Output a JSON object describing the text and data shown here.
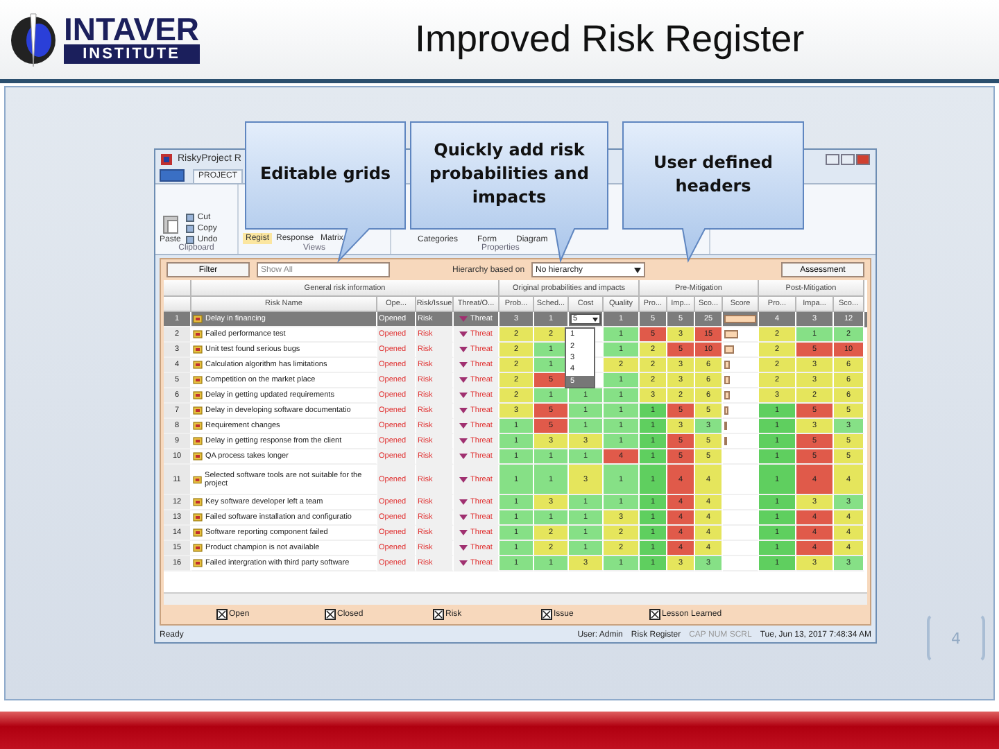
{
  "slide": {
    "logo": {
      "line1": "INTAVER",
      "line2": "INSTITUTE"
    },
    "title": "Improved Risk Register",
    "page_number": "4"
  },
  "callouts": [
    {
      "text": "Editable grids"
    },
    {
      "text": "Quickly add risk probabilities and impacts"
    },
    {
      "text": "User defined headers"
    }
  ],
  "app": {
    "title": "RiskyProject R",
    "tabs": [
      {
        "label": "PROJECT",
        "selected": true
      }
    ],
    "clipboard": {
      "paste": "Paste",
      "items": [
        "Cut",
        "Copy",
        "Undo"
      ],
      "label": "Clipboard"
    },
    "views": {
      "items": [
        {
          "label": "Regist",
          "selected": true
        },
        {
          "label": "Response",
          "selected": false
        },
        {
          "label": "Matrix",
          "selected": false
        }
      ],
      "label": "Views"
    },
    "properties": {
      "items": [
        "Categories",
        "Form",
        "Diagram"
      ],
      "label": "Properties"
    },
    "filter": {
      "button": "Filter",
      "value": "Show All",
      "hierarchy_label": "Hierarchy based on",
      "hierarchy_value": "No hierarchy",
      "assessment": "Assessment"
    },
    "groups": [
      "General risk information",
      "Original probabilities and impacts",
      "Pre-Mitigation",
      "Post-Mitigation"
    ],
    "columns": [
      "Risk Name",
      "Ope...",
      "Risk/Issue",
      "Threat/O...",
      "Prob...",
      "Sched...",
      "Cost",
      "Quality",
      "Pro...",
      "Imp...",
      "Sco...",
      "Score",
      "Pro...",
      "Impa...",
      "Sco..."
    ],
    "cost_dropdown": {
      "value": "5",
      "options": [
        {
          "label": "1",
          "selected": false
        },
        {
          "label": "2",
          "selected": false
        },
        {
          "label": "3",
          "selected": false
        },
        {
          "label": "4",
          "selected": false
        },
        {
          "label": "5",
          "selected": true
        }
      ]
    },
    "rows": [
      {
        "num": "1",
        "name": "Delay in financing",
        "status": "Opened",
        "type": "Risk",
        "effect": "Threat",
        "selected": true,
        "probability": "3",
        "schedule": "1",
        "quality": "1",
        "pre": [
          "5",
          "5",
          "25"
        ],
        "level": 1,
        "post": [
          "4",
          "3",
          "12"
        ]
      },
      {
        "num": "2",
        "name": "Failed performance test",
        "status": "Opened",
        "type": "Risk",
        "effect": "Threat",
        "selected": false,
        "probability": "2",
        "schedule": "2",
        "quality": "1",
        "pre": [
          "5",
          "3",
          "15"
        ],
        "level": 0.45,
        "post": [
          "2",
          "1",
          "2"
        ]
      },
      {
        "num": "3",
        "name": "Unit test found serious bugs",
        "status": "Opened",
        "type": "Risk",
        "effect": "Threat",
        "selected": false,
        "probability": "2",
        "schedule": "1",
        "quality": "1",
        "pre": [
          "2",
          "5",
          "10"
        ],
        "level": 0.3,
        "post": [
          "2",
          "5",
          "10"
        ]
      },
      {
        "num": "4",
        "name": "Calculation algorithm has limitations",
        "status": "Opened",
        "type": "Risk",
        "effect": "Threat",
        "selected": false,
        "probability": "2",
        "schedule": "1",
        "quality": "2",
        "pre": [
          "2",
          "3",
          "6"
        ],
        "level": 0.18,
        "post": [
          "2",
          "3",
          "6"
        ]
      },
      {
        "num": "5",
        "name": "Competition on the market place",
        "status": "Opened",
        "type": "Risk",
        "effect": "Threat",
        "selected": false,
        "probability": "2",
        "schedule": "5",
        "quality": "1",
        "pre": [
          "2",
          "3",
          "6"
        ],
        "level": 0.18,
        "post": [
          "2",
          "3",
          "6"
        ]
      },
      {
        "num": "6",
        "name": "Delay in getting updated requirements",
        "status": "Opened",
        "type": "Risk",
        "effect": "Threat",
        "selected": false,
        "probability": "2",
        "schedule": "1",
        "cost": "1",
        "quality": "1",
        "pre": [
          "3",
          "2",
          "6"
        ],
        "level": 0.18,
        "post": [
          "3",
          "2",
          "6"
        ]
      },
      {
        "num": "7",
        "name": "Delay in developing software documentatio",
        "status": "Opened",
        "type": "Risk",
        "effect": "Threat",
        "selected": false,
        "probability": "3",
        "schedule": "5",
        "cost": "1",
        "quality": "1",
        "pre": [
          "1",
          "5",
          "5"
        ],
        "level": 0.15,
        "post": [
          "1",
          "5",
          "5"
        ]
      },
      {
        "num": "8",
        "name": "Requirement changes",
        "status": "Opened",
        "type": "Risk",
        "effect": "Threat",
        "selected": false,
        "probability": "1",
        "schedule": "5",
        "cost": "1",
        "quality": "1",
        "pre": [
          "1",
          "3",
          "3"
        ],
        "level": 0.1,
        "post": [
          "1",
          "3",
          "3"
        ]
      },
      {
        "num": "9",
        "name": "Delay in getting response from the client",
        "status": "Opened",
        "type": "Risk",
        "effect": "Threat",
        "selected": false,
        "probability": "1",
        "schedule": "3",
        "cost": "3",
        "quality": "1",
        "pre": [
          "1",
          "5",
          "5"
        ],
        "level": 0.1,
        "post": [
          "1",
          "5",
          "5"
        ]
      },
      {
        "num": "10",
        "name": "QA process takes longer",
        "status": "Opened",
        "type": "Risk",
        "effect": "Threat",
        "selected": false,
        "probability": "1",
        "schedule": "1",
        "cost": "1",
        "quality": "4",
        "pre": [
          "1",
          "5",
          "5"
        ],
        "post": [
          "1",
          "5",
          "5"
        ]
      },
      {
        "num": "11",
        "name": "Selected software tools are not suitable for the project",
        "status": "Opened",
        "type": "Risk",
        "effect": "Threat",
        "selected": false,
        "probability": "1",
        "schedule": "1",
        "cost": "3",
        "quality": "1",
        "pre": [
          "1",
          "4",
          "4"
        ],
        "post": [
          "1",
          "4",
          "4"
        ]
      },
      {
        "num": "12",
        "name": "Key software developer left a team",
        "status": "Opened",
        "type": "Risk",
        "effect": "Threat",
        "selected": false,
        "probability": "1",
        "schedule": "3",
        "cost": "1",
        "quality": "1",
        "pre": [
          "1",
          "4",
          "4"
        ],
        "post": [
          "1",
          "3",
          "3"
        ]
      },
      {
        "num": "13",
        "name": "Failed software installation and configuratio",
        "status": "Opened",
        "type": "Risk",
        "effect": "Threat",
        "selected": false,
        "probability": "1",
        "schedule": "1",
        "cost": "1",
        "quality": "3",
        "pre": [
          "1",
          "4",
          "4"
        ],
        "post": [
          "1",
          "4",
          "4"
        ]
      },
      {
        "num": "14",
        "name": "Software reporting component failed",
        "status": "Opened",
        "type": "Risk",
        "effect": "Threat",
        "selected": false,
        "probability": "1",
        "schedule": "2",
        "cost": "1",
        "quality": "2",
        "pre": [
          "1",
          "4",
          "4"
        ],
        "post": [
          "1",
          "4",
          "4"
        ]
      },
      {
        "num": "15",
        "name": "Product champion is not available",
        "status": "Opened",
        "type": "Risk",
        "effect": "Threat",
        "selected": false,
        "probability": "1",
        "schedule": "2",
        "cost": "1",
        "quality": "2",
        "pre": [
          "1",
          "4",
          "4"
        ],
        "post": [
          "1",
          "4",
          "4"
        ]
      },
      {
        "num": "16",
        "name": "Failed intergration with third party software",
        "status": "Opened",
        "type": "Risk",
        "effect": "Threat",
        "selected": false,
        "probability": "1",
        "schedule": "1",
        "cost": "3",
        "quality": "1",
        "pre": [
          "1",
          "3",
          "3"
        ],
        "post": [
          "1",
          "3",
          "3"
        ]
      }
    ],
    "legend": [
      {
        "label": "Open",
        "checked": true
      },
      {
        "label": "Closed",
        "checked": true
      },
      {
        "label": "Risk",
        "checked": true
      },
      {
        "label": "Issue",
        "checked": true
      },
      {
        "label": "Lesson Learned",
        "checked": true
      }
    ],
    "status_bar": {
      "left": "Ready",
      "user": "User: Admin",
      "view": "Risk Register",
      "keys": "CAP NUM SCRL",
      "datetime": "Tue, Jun 13, 2017 7:48:34 AM"
    }
  }
}
